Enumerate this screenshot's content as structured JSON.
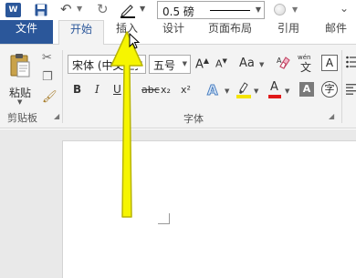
{
  "quick_access": {
    "app_logo_text": "W",
    "line_weight_value": "0.5 磅"
  },
  "tabs": {
    "file": "文件",
    "home": "开始",
    "insert": "插入",
    "design": "设计",
    "page_layout": "页面布局",
    "references": "引用",
    "mailings": "邮件"
  },
  "ribbon": {
    "clipboard": {
      "paste_label": "粘贴",
      "group_label": "剪贴板"
    },
    "font": {
      "font_name": "宋体 (中文正文",
      "font_size": "五号",
      "grow_label": "A",
      "shrink_label": "A",
      "case_label": "Aa",
      "phonetic_top": "wén",
      "phonetic_char": "文",
      "char_border_label": "A",
      "bold_label": "B",
      "italic_label": "I",
      "underline_label": "U",
      "strike_label": "abc",
      "subscript_label": "x₂",
      "superscript_label": "x²",
      "effects_label": "A",
      "font_color_label": "A",
      "shading_label": "A",
      "enclose_label": "字",
      "group_label": "字体"
    }
  },
  "colors": {
    "brand": "#2b579a",
    "ribbon_bg": "#f3f3f3",
    "arrow": "#f6f500",
    "font_color": "#e01919",
    "highlight": "#f5e400"
  },
  "icons": {
    "save": "save-icon",
    "undo": "undo-icon",
    "redo": "redo-icon",
    "cut": "scissors-icon",
    "copy": "copy-icon",
    "format_painter": "paintbrush-icon"
  }
}
